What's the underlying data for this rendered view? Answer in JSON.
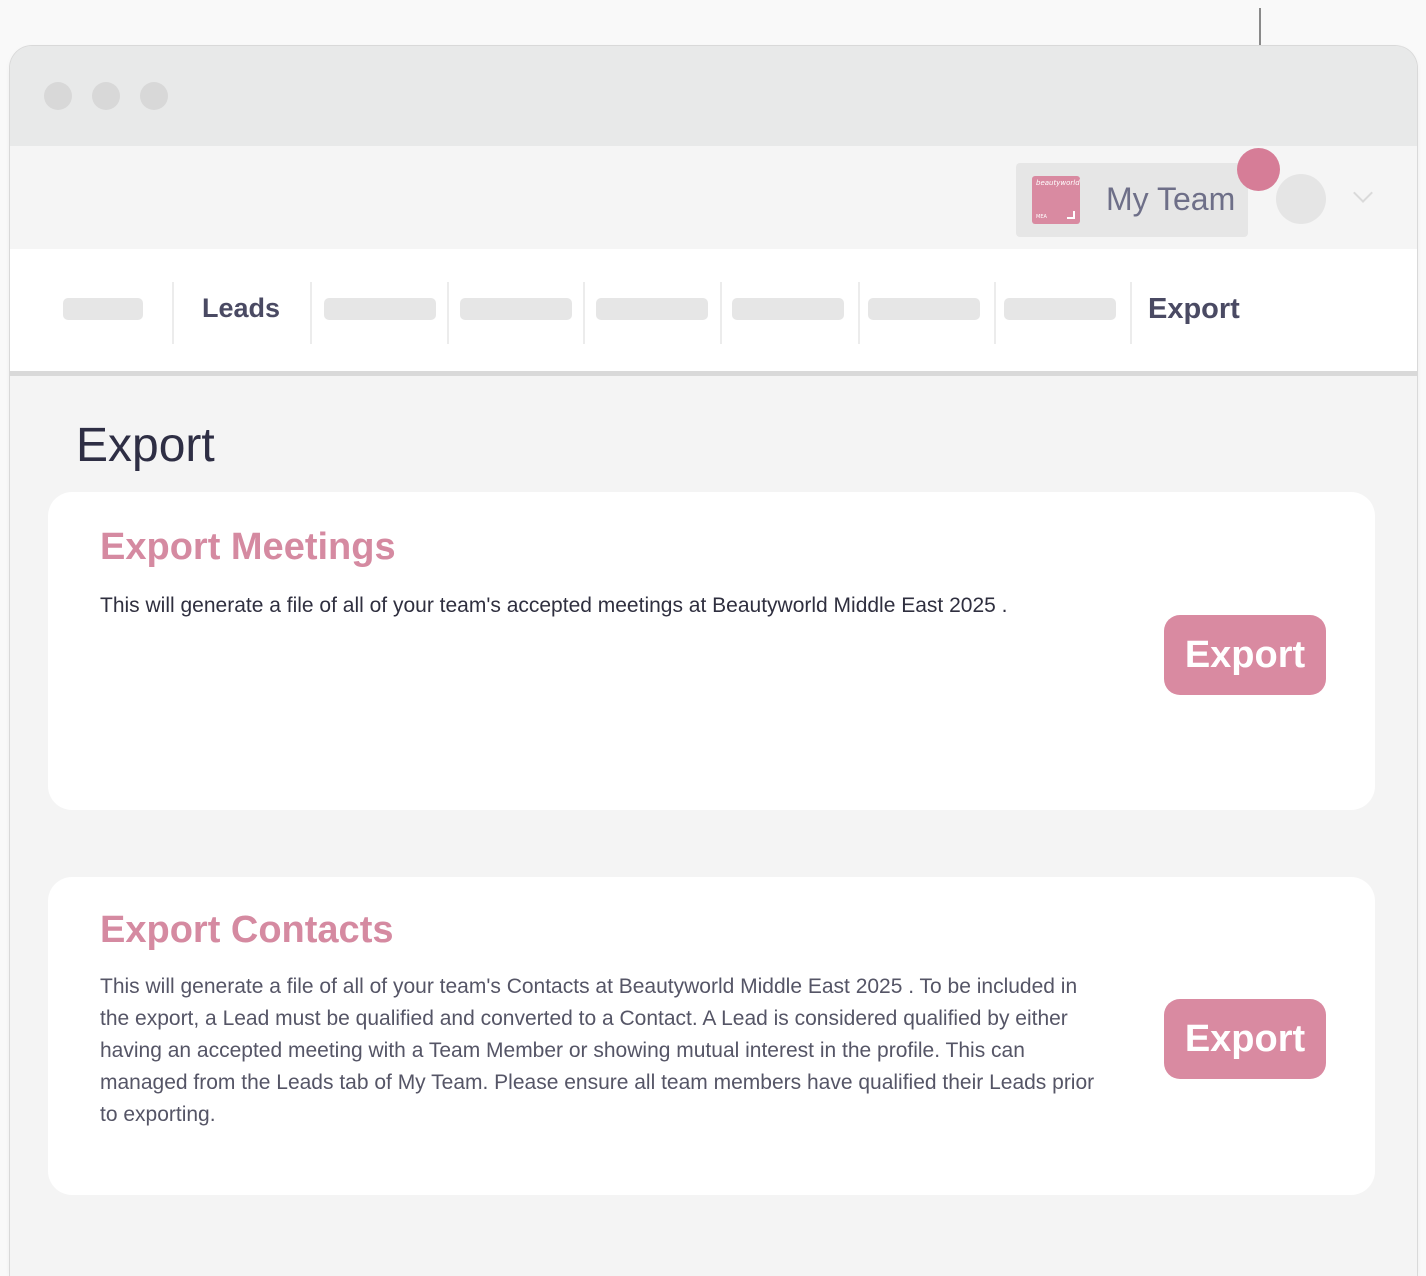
{
  "window": {
    "traffic_lights": [
      "close-light",
      "minimize-light",
      "maximize-light"
    ]
  },
  "app_bar": {
    "team_label": "My Team",
    "team_logo": {
      "top_text": "beautyworld",
      "bottom_text": "MEA",
      "color": "#d98aa1"
    }
  },
  "nav": {
    "tabs": [
      {
        "label": "",
        "placeholder": true
      },
      {
        "label": "Leads",
        "placeholder": false
      },
      {
        "label": "",
        "placeholder": true
      },
      {
        "label": "",
        "placeholder": true
      },
      {
        "label": "",
        "placeholder": true
      },
      {
        "label": "",
        "placeholder": true
      },
      {
        "label": "",
        "placeholder": true
      },
      {
        "label": "",
        "placeholder": true
      },
      {
        "label": "Export",
        "placeholder": false,
        "active": true
      }
    ]
  },
  "page": {
    "title": "Export"
  },
  "cards": [
    {
      "title": "Export Meetings",
      "description": "This will generate a file of all of your team's accepted meetings at Beautyworld Middle East 2025 .",
      "button_label": "Export"
    },
    {
      "title": "Export Contacts",
      "description": "This will generate a file of all of your team's Contacts at Beautyworld Middle East 2025 . To be included in the export, a Lead must be qualified and converted to a Contact. A Lead is considered qualified by either having an accepted meeting with a Team Member or showing mutual interest in the profile. This can managed from the Leads tab of My Team. Please ensure all team members have qualified their Leads prior to exporting.",
      "button_label": "Export"
    }
  ],
  "colors": {
    "accent": "#d98aa1",
    "title_text": "#2e2e44",
    "nav_text": "#4a4a63"
  }
}
